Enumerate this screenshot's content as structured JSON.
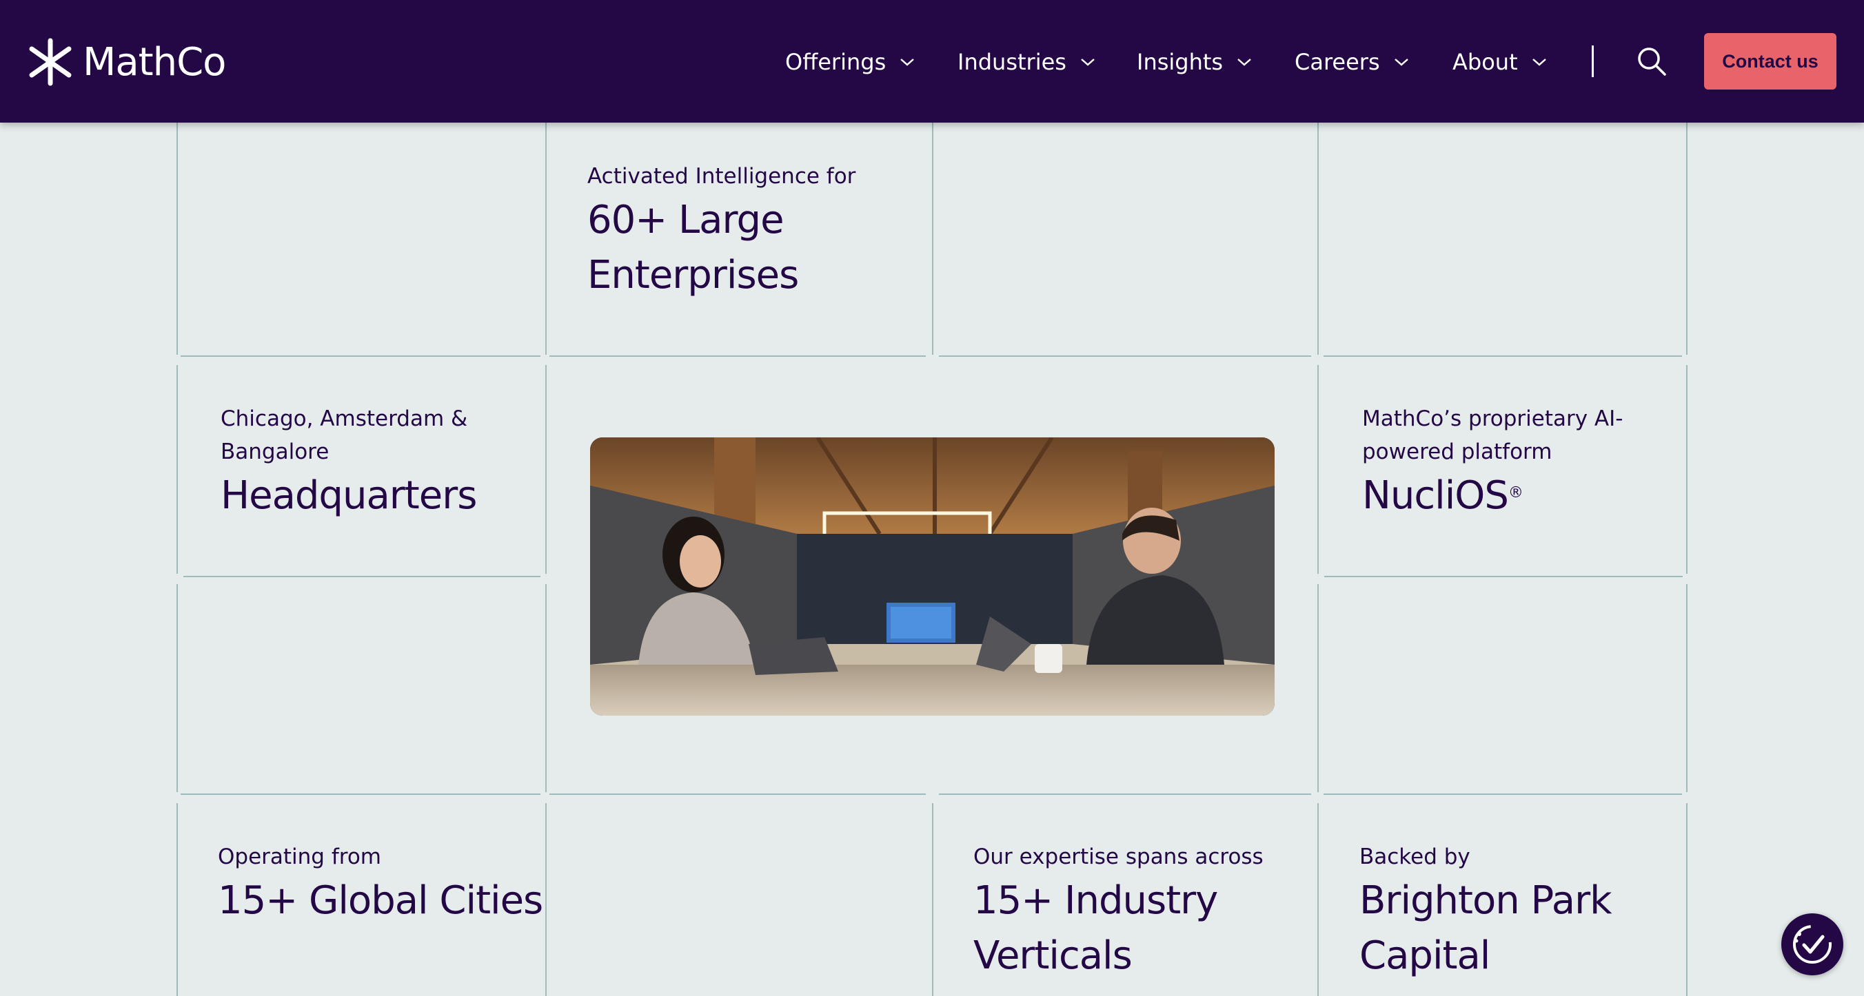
{
  "header": {
    "logo_text": "MathCo",
    "nav": [
      {
        "label": "Offerings"
      },
      {
        "label": "Industries"
      },
      {
        "label": "Insights"
      },
      {
        "label": "Careers"
      },
      {
        "label": "About"
      }
    ],
    "contact_label": "Contact us"
  },
  "stats": {
    "enterprises": {
      "sub": "Activated Intelligence for",
      "line1": "60+ Large",
      "line2": "Enterprises"
    },
    "headquarters": {
      "sub1": "Chicago, Amsterdam &",
      "sub2": "Bangalore",
      "big": "Headquarters"
    },
    "platform": {
      "sub1": "MathCo’s proprietary AI-",
      "sub2": "powered platform",
      "big": "NucliOS",
      "mark": "®"
    },
    "cities": {
      "sub": "Operating from",
      "big": "15+ Global Cities"
    },
    "industries": {
      "sub": "Our expertise spans across",
      "line1": "15+ Industry",
      "line2": "Verticals"
    },
    "backing": {
      "sub": "Backed by",
      "line1": "Brighton Park",
      "line2": "Capital"
    }
  },
  "colors": {
    "header_bg": "#230845",
    "page_bg": "#e6ecec",
    "accent": "#e8646a",
    "grid_line": "#9fbbbb"
  },
  "icons": {
    "logo": "asterisk-logo-icon",
    "dropdown": "chevron-down-icon",
    "search": "search-icon",
    "badge": "accessibility-check-icon"
  }
}
